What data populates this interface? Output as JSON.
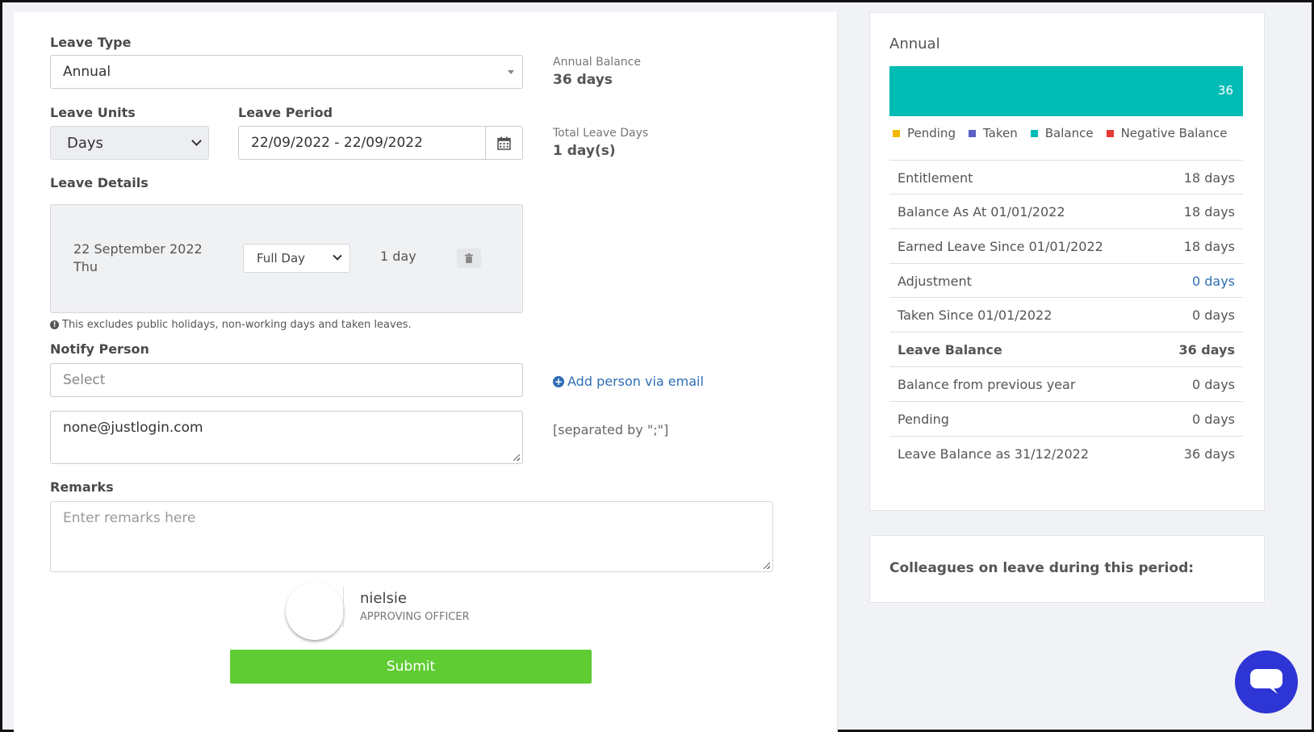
{
  "form": {
    "leave_type_label": "Leave Type",
    "leave_type_value": "Annual",
    "leave_units_label": "Leave Units",
    "leave_units_value": "Days",
    "leave_period_label": "Leave Period",
    "leave_period_value": "22/09/2022 - 22/09/2022",
    "annual_balance_label": "Annual Balance",
    "annual_balance_value": "36 days",
    "total_days_label": "Total Leave Days",
    "total_days_value": "1 day(s)",
    "leave_details_label": "Leave Details",
    "detail_date": "22 September 2022",
    "detail_weekday": "Thu",
    "detail_duration_option": "Full Day",
    "detail_days": "1 day",
    "note": "This excludes public holidays, non-working days and taken leaves.",
    "notify_label": "Notify Person",
    "notify_placeholder": "Select",
    "add_person_link": "Add person via email",
    "email_value": "none@justlogin.com",
    "email_hint": "[separated by \";\"]",
    "remarks_label": "Remarks",
    "remarks_placeholder": "Enter remarks here",
    "approver_name": "nielsie",
    "approver_role": "APPROVING OFFICER",
    "submit_label": "Submit"
  },
  "balance_panel": {
    "title": "Annual",
    "bar_value": "36",
    "bar_fraction": 1.0,
    "legend": [
      {
        "label": "Pending",
        "color": "#f5b800"
      },
      {
        "label": "Taken",
        "color": "#5b5fc7"
      },
      {
        "label": "Balance",
        "color": "#00bcb4"
      },
      {
        "label": "Negative Balance",
        "color": "#e53935"
      }
    ],
    "rows": [
      {
        "label": "Entitlement",
        "value": "18 days"
      },
      {
        "label": "Balance As At 01/01/2022",
        "value": "18 days"
      },
      {
        "label": "Earned Leave Since 01/01/2022",
        "value": "18 days"
      },
      {
        "label": "Adjustment",
        "value": "0 days"
      },
      {
        "label": "Taken Since 01/01/2022",
        "value": "0 days"
      },
      {
        "label": "Leave Balance",
        "value": "36 days"
      },
      {
        "label": "Balance from previous year",
        "value": "0 days"
      },
      {
        "label": "Pending",
        "value": "0 days"
      },
      {
        "label": "Leave Balance as 31/12/2022",
        "value": "36 days"
      }
    ]
  },
  "colleagues_panel": {
    "title": "Colleagues on leave during this period:"
  },
  "colors": {
    "accent_bar": "#00bcb4",
    "submit_green": "#5fcc33",
    "link_blue": "#2f6db5",
    "chat_button": "#2d35d4"
  }
}
